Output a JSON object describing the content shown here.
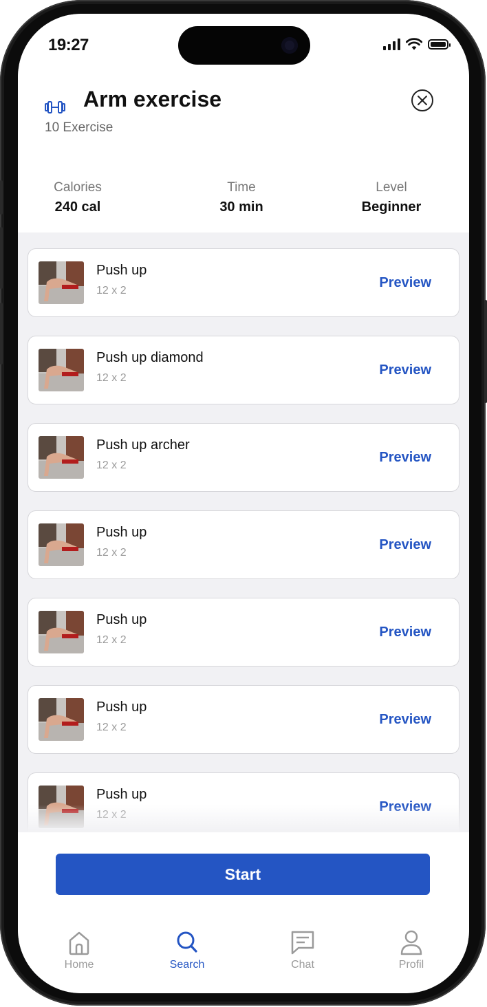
{
  "status_bar": {
    "time": "19:27"
  },
  "header": {
    "title": "Arm exercise",
    "subtitle": "10 Exercise"
  },
  "stats": [
    {
      "label": "Calories",
      "value": "240 cal"
    },
    {
      "label": "Time",
      "value": "30 min"
    },
    {
      "label": "Level",
      "value": "Beginner"
    }
  ],
  "exercises": [
    {
      "name": "Push up",
      "reps": "12 x 2",
      "action": "Preview"
    },
    {
      "name": "Push up diamond",
      "reps": "12 x 2",
      "action": "Preview"
    },
    {
      "name": "Push up archer",
      "reps": "12 x 2",
      "action": "Preview"
    },
    {
      "name": "Push up",
      "reps": "12 x 2",
      "action": "Preview"
    },
    {
      "name": "Push up",
      "reps": "12 x 2",
      "action": "Preview"
    },
    {
      "name": "Push up",
      "reps": "12 x 2",
      "action": "Preview"
    },
    {
      "name": "Push up",
      "reps": "12 x 2",
      "action": "Preview"
    }
  ],
  "start_button": {
    "label": "Start"
  },
  "nav": [
    {
      "label": "Home",
      "icon": "home-icon"
    },
    {
      "label": "Search",
      "icon": "search-icon",
      "active": true
    },
    {
      "label": "Chat",
      "icon": "chat-icon"
    },
    {
      "label": "Profil",
      "icon": "profile-icon"
    }
  ],
  "colors": {
    "accent": "#2455c3",
    "background": "#f1f1f4",
    "text": "#111111",
    "muted": "#9a9a9a"
  }
}
